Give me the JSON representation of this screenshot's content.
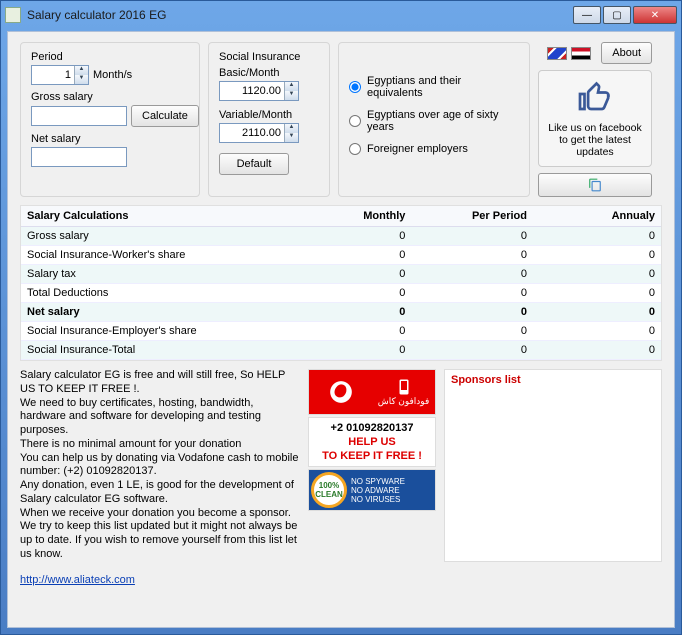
{
  "window": {
    "title": "Salary calculator 2016 EG"
  },
  "period": {
    "label": "Period",
    "value": "1",
    "unit": "Month/s"
  },
  "gross": {
    "label": "Gross salary",
    "value": ""
  },
  "net": {
    "label": "Net salary",
    "value": ""
  },
  "calculate_btn": "Calculate",
  "social": {
    "title": "Social Insurance",
    "basic_label": "Basic/Month",
    "basic_value": "1120.00",
    "variable_label": "Variable/Month",
    "variable_value": "2110.00",
    "default_btn": "Default"
  },
  "radios": {
    "opt1": "Egyptians and their equivalents",
    "opt2": "Egyptians over age of sixty years",
    "opt3": "Foreigner employers"
  },
  "about_btn": "About",
  "fb_text": "Like us on facebook to get the latest updates",
  "chart_data": {
    "type": "table",
    "title": "Salary Calculations",
    "columns": [
      "Salary Calculations",
      "Monthly",
      "Per Period",
      "Annualy"
    ],
    "rows": [
      {
        "label": "Gross salary",
        "monthly": "0",
        "per_period": "0",
        "annualy": "0",
        "bold": false
      },
      {
        "label": "Social Insurance-Worker's share",
        "monthly": "0",
        "per_period": "0",
        "annualy": "0",
        "bold": false
      },
      {
        "label": "Salary tax",
        "monthly": "0",
        "per_period": "0",
        "annualy": "0",
        "bold": false
      },
      {
        "label": "Total Deductions",
        "monthly": "0",
        "per_period": "0",
        "annualy": "0",
        "bold": false
      },
      {
        "label": "Net salary",
        "monthly": "0",
        "per_period": "0",
        "annualy": "0",
        "bold": true
      },
      {
        "label": "Social Insurance-Employer's share",
        "monthly": "0",
        "per_period": "0",
        "annualy": "0",
        "bold": false
      },
      {
        "label": "Social Insurance-Total",
        "monthly": "0",
        "per_period": "0",
        "annualy": "0",
        "bold": false
      }
    ]
  },
  "donate_text": "Salary calculator EG is free and will still free, So HELP US TO KEEP IT FREE !.\nWe need to buy certificates, hosting, bandwidth, hardware and software for developing and testing purposes.\nThere is no minimal amount for your donation\nYou can help us by donating via Vodafone cash to mobile number: (+2) 01092820137.\nAny donation, even 1 LE, is good for the development of Salary calculator EG software.\nWhen we receive your donation you become a sponsor. We try to keep this list updated but it might not always be up to date. If you wish to remove yourself from this list let us know.",
  "ad": {
    "vodafone_ar": "فودافون كاش",
    "phone": "+2 01092820137",
    "help1": "HELP US",
    "help2": "TO KEEP IT FREE !",
    "clean_pct": "100%",
    "clean_txt": "CLEAN",
    "badge_lines": [
      "NO SPYWARE",
      "NO ADWARE",
      "NO VIRUSES"
    ]
  },
  "sponsors": {
    "title": "Sponsors list"
  },
  "footer_url": "http://www.aliateck.com"
}
